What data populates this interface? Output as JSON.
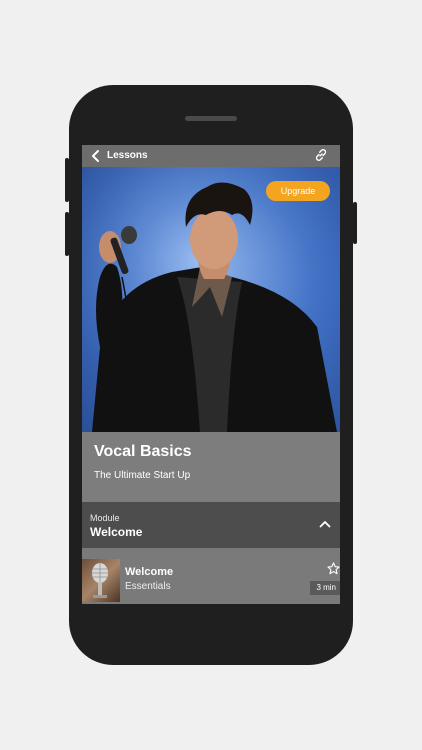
{
  "topbar": {
    "back_icon": "chevron-left-icon",
    "title": "Lessons",
    "share_icon": "link-icon"
  },
  "hero": {
    "upgrade_label": "Upgrade",
    "image_desc_icon": "singer-photo",
    "accent_color": "#f4a41f"
  },
  "course": {
    "title": "Vocal Basics",
    "subtitle": "The Ultimate Start Up"
  },
  "module": {
    "label": "Module",
    "name": "Welcome",
    "toggle_icon": "chevron-up-icon"
  },
  "lessons": [
    {
      "title": "Welcome",
      "subtitle": "Essentials",
      "duration": "3 min",
      "favorite_icon": "star-icon",
      "thumbnail_icon": "microphone-thumbnail"
    }
  ]
}
